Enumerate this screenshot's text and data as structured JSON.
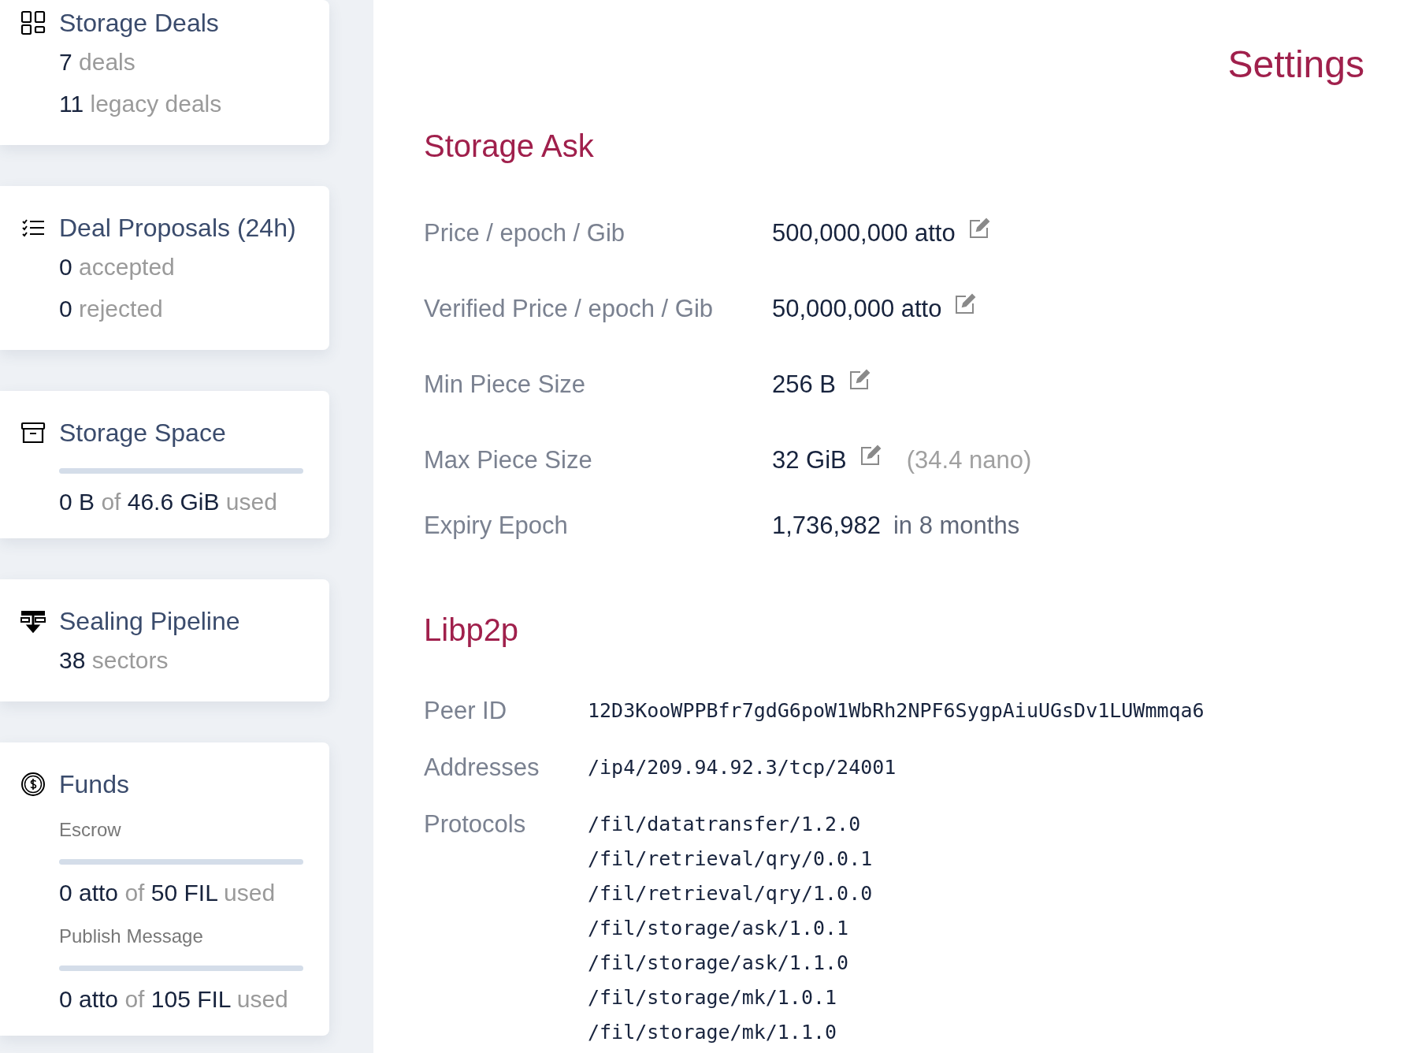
{
  "sidebar": {
    "cards": [
      {
        "kind": "deals",
        "title": "Storage Deals",
        "lines": [
          {
            "value": "7",
            "unit": "deals"
          },
          {
            "value": "11",
            "unit": "legacy deals"
          }
        ]
      },
      {
        "kind": "proposals",
        "title": "Deal Proposals (24h)",
        "lines": [
          {
            "value": "0",
            "unit": "accepted"
          },
          {
            "value": "0",
            "unit": "rejected"
          }
        ]
      },
      {
        "kind": "space",
        "title": "Storage Space",
        "meters": [
          {
            "level": 0,
            "used": "0 B",
            "of": "of",
            "total": "46.6 GiB",
            "suffix": "used"
          }
        ]
      },
      {
        "kind": "pipeline",
        "title": "Sealing Pipeline",
        "lines": [
          {
            "value": "38",
            "unit": "sectors"
          }
        ]
      },
      {
        "kind": "funds",
        "title": "Funds",
        "meters": [
          {
            "label": "Escrow",
            "level": 0,
            "used": "0 atto",
            "of": "of",
            "total": "50 FIL",
            "suffix": "used"
          },
          {
            "label": "Publish Message",
            "level": 0,
            "used": "0 atto",
            "of": "of",
            "total": "105 FIL",
            "suffix": "used"
          }
        ]
      }
    ]
  },
  "main": {
    "title": "Settings",
    "storage_ask": {
      "heading": "Storage Ask",
      "rows": [
        {
          "label": "Price / epoch / Gib",
          "value": "500,000,000 atto",
          "editable": true
        },
        {
          "label": "Verified Price / epoch / Gib",
          "value": "50,000,000 atto",
          "editable": true
        },
        {
          "label": "Min Piece Size",
          "value": "256 B",
          "editable": true
        },
        {
          "label": "Max Piece Size",
          "value": "32 GiB",
          "editable": true,
          "note": "(34.4 nano)"
        },
        {
          "label": "Expiry Epoch",
          "value": "1,736,982",
          "editable": false,
          "relative": "in 8 months"
        }
      ]
    },
    "libp2p": {
      "heading": "Libp2p",
      "rows": [
        {
          "label": "Peer ID",
          "values": [
            "12D3KooWPPBfr7gdG6poW1WbRh2NPF6SygpAiuUGsDv1LUWmmqa6"
          ]
        },
        {
          "label": "Addresses",
          "values": [
            "/ip4/209.94.92.3/tcp/24001"
          ]
        },
        {
          "label": "Protocols",
          "values": [
            "/fil/datatransfer/1.2.0",
            "/fil/retrieval/qry/0.0.1",
            "/fil/retrieval/qry/1.0.0",
            "/fil/storage/ask/1.0.1",
            "/fil/storage/ask/1.1.0",
            "/fil/storage/mk/1.0.1",
            "/fil/storage/mk/1.1.0"
          ]
        }
      ]
    }
  }
}
